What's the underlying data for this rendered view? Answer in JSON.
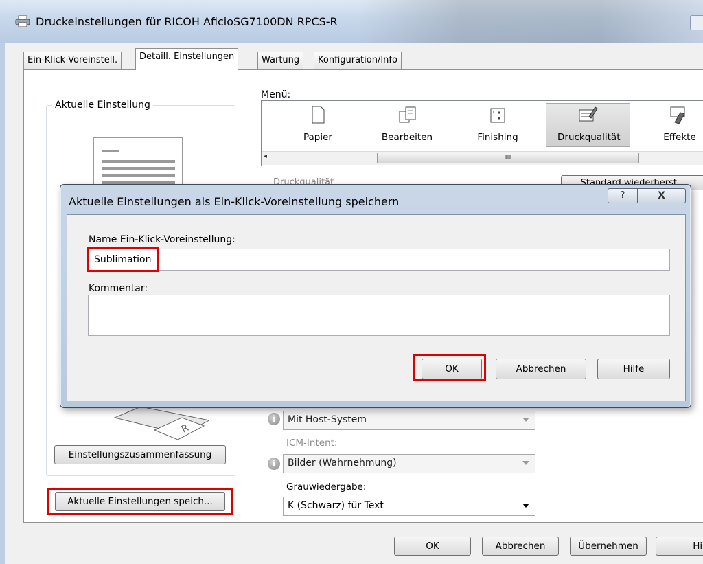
{
  "window": {
    "title": "Druckeinstellungen für RICOH AficioSG7100DN RPCS-R"
  },
  "tabs": [
    {
      "label": "Ein-Klick-Voreinstell."
    },
    {
      "label": "Detaill. Einstellungen",
      "selected": true
    },
    {
      "label": "Wartung"
    },
    {
      "label": "Konfiguration/Info"
    }
  ],
  "left_panel": {
    "group_label": "Aktuelle Einstellung",
    "summary_button": "Einstellungszusammenfassung",
    "save_button": "Aktuelle Einstellungen speich..."
  },
  "menu": {
    "label": "Menü:",
    "items": [
      {
        "label": "Papier",
        "icon": "paper-icon"
      },
      {
        "label": "Bearbeiten",
        "icon": "edit-icon"
      },
      {
        "label": "Finishing",
        "icon": "finishing-icon"
      },
      {
        "label": "Druckqualität",
        "icon": "print-quality-icon",
        "selected": true
      },
      {
        "label": "Effekte",
        "icon": "effects-icon"
      }
    ],
    "scroll_left": "◂",
    "scroll_thumb": "III"
  },
  "section": {
    "title_partial": "Druckqualität",
    "standard_button_partial": "Standard wiederherst..."
  },
  "settings": {
    "color_profile_value": "Mit Host-System",
    "icm_intent_label": "ICM-Intent:",
    "icm_intent_value": "Bilder (Wahrnehmung)",
    "gray_label": "Grauwiedergabe:",
    "gray_value": "K (Schwarz) für Text"
  },
  "footer": {
    "ok": "OK",
    "cancel": "Abbrechen",
    "apply": "Übernehmen",
    "help": "Hilfe"
  },
  "dialog": {
    "title": "Aktuelle Einstellungen als Ein-Klick-Voreinstellung speichern",
    "help_glyph": "?",
    "close_glyph": "X",
    "name_label": "Name Ein-Klick-Voreinstellung:",
    "name_value": "Sublimation",
    "comment_label": "Kommentar:",
    "comment_value": "",
    "ok": "OK",
    "cancel": "Abbrechen",
    "help": "Hilfe"
  },
  "colors": {
    "highlight": "#e00000",
    "title_bar": "#c9d9ec"
  }
}
